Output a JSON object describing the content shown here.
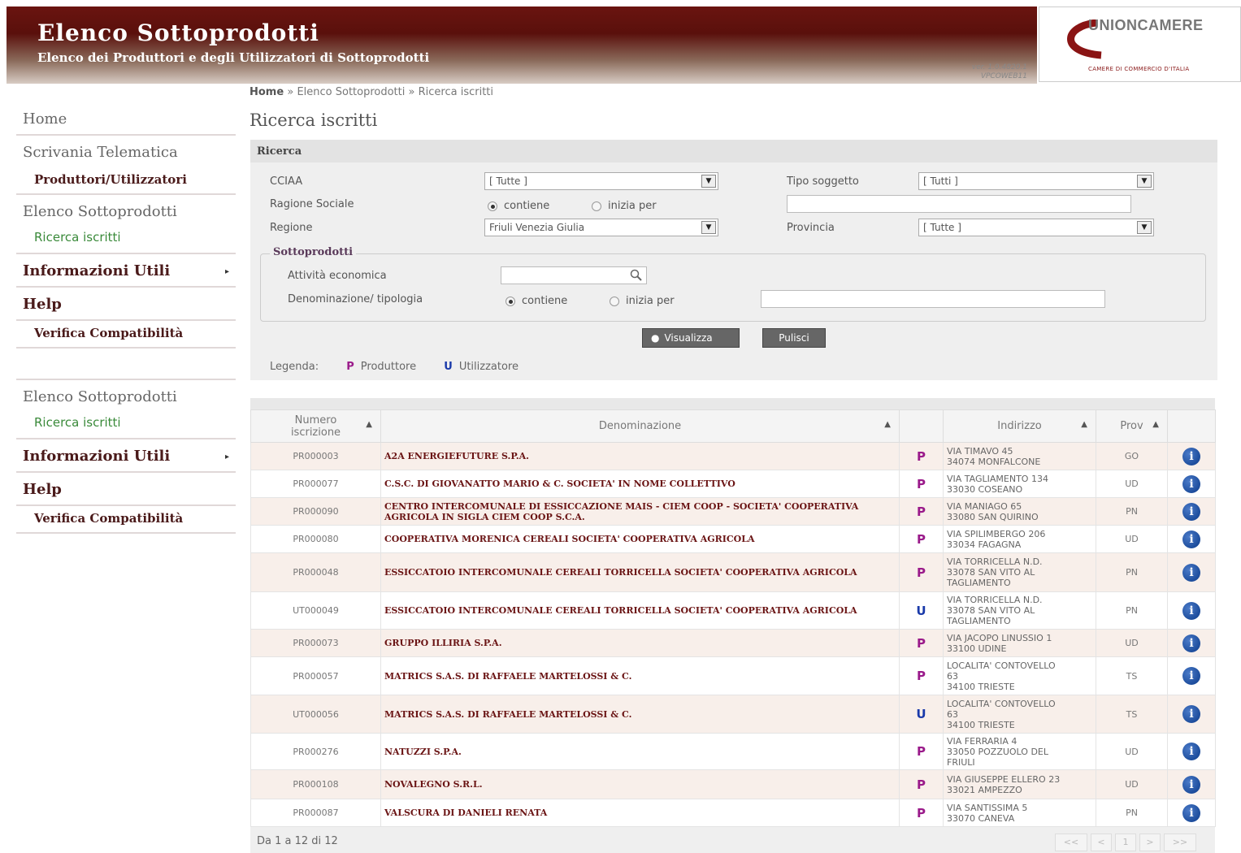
{
  "header": {
    "title": "Elenco Sottoprodotti",
    "subtitle": "Elenco dei Produttori e degli Utilizzatori di Sottoprodotti",
    "version_line1": "ver. 1.0.4820.1",
    "version_line2": "VPCOWEB11",
    "logo_text": "UNIONCAMERE",
    "logo_sub": "CAMERE DI COMMERCIO D'ITALIA"
  },
  "sidebar_top": {
    "home": "Home",
    "scrivania": "Scrivania Telematica",
    "produttori": "Produttori/Utilizzatori",
    "elenco": "Elenco Sottoprodotti",
    "ricerca": "Ricerca iscritti",
    "info": "Informazioni Utili",
    "help": "Help",
    "verifica": "Verifica Compatibilità"
  },
  "sidebar_bottom": {
    "elenco": "Elenco Sottoprodotti",
    "ricerca": "Ricerca iscritti",
    "info": "Informazioni Utili",
    "help": "Help",
    "verifica": "Verifica Compatibilità"
  },
  "breadcrumb": {
    "home": "Home",
    "sep": "»",
    "level1": "Elenco Sottoprodotti",
    "level2": "Ricerca iscritti"
  },
  "page_title": "Ricerca iscritti",
  "search": {
    "panel_title": "Ricerca",
    "cciaa_label": "CCIAA",
    "cciaa_value": "[ Tutte ]",
    "tipo_label": "Tipo soggetto",
    "tipo_value": "[ Tutti ]",
    "ragione_label": "Ragione Sociale",
    "opt_contiene": "contiene",
    "opt_inizia": "inizia per",
    "regione_label": "Regione",
    "regione_value": "Friuli Venezia Giulia",
    "provincia_label": "Provincia",
    "provincia_value": "[ Tutte ]",
    "sottoprodotti_legend": "Sottoprodotti",
    "attivita_label": "Attività economica",
    "denominazione_label": "Denominazione/ tipologia",
    "visualizza": "Visualizza",
    "pulisci": "Pulisci",
    "legenda_label": "Legenda:",
    "legend_p": "P",
    "legend_p_text": "Produttore",
    "legend_u": "U",
    "legend_u_text": "Utilizzatore"
  },
  "table": {
    "col_numero": "Numero iscrizione",
    "col_denominazione": "Denominazione",
    "col_indirizzo": "Indirizzo",
    "col_prov": "Prov",
    "rows": [
      {
        "num": "PR000003",
        "den": "A2A ENERGIEFUTURE S.P.A.",
        "type": "P",
        "addr": "VIA TIMAVO 45\n34074 MONFALCONE",
        "prov": "GO"
      },
      {
        "num": "PR000077",
        "den": "C.S.C. DI GIOVANATTO MARIO & C. SOCIETA' IN NOME COLLETTIVO",
        "type": "P",
        "addr": "VIA TAGLIAMENTO 134\n33030 COSEANO",
        "prov": "UD"
      },
      {
        "num": "PR000090",
        "den": "CENTRO INTERCOMUNALE DI ESSICCAZIONE MAIS - CIEM COOP - SOCIETA' COOPERATIVA AGRICOLA IN SIGLA CIEM COOP S.C.A.",
        "type": "P",
        "addr": "VIA MANIAGO 65\n33080 SAN QUIRINO",
        "prov": "PN"
      },
      {
        "num": "PR000080",
        "den": "COOPERATIVA MORENICA CEREALI SOCIETA' COOPERATIVA AGRICOLA",
        "type": "P",
        "addr": "VIA SPILIMBERGO 206\n33034 FAGAGNA",
        "prov": "UD"
      },
      {
        "num": "PR000048",
        "den": "ESSICCATOIO INTERCOMUNALE CEREALI TORRICELLA SOCIETA' COOPERATIVA AGRICOLA",
        "type": "P",
        "addr": "VIA TORRICELLA N.D.\n33078 SAN VITO AL\nTAGLIAMENTO",
        "prov": "PN"
      },
      {
        "num": "UT000049",
        "den": "ESSICCATOIO INTERCOMUNALE CEREALI TORRICELLA SOCIETA' COOPERATIVA AGRICOLA",
        "type": "U",
        "addr": "VIA TORRICELLA N.D.\n33078 SAN VITO AL\nTAGLIAMENTO",
        "prov": "PN"
      },
      {
        "num": "PR000073",
        "den": "GRUPPO ILLIRIA S.P.A.",
        "type": "P",
        "addr": "VIA JACOPO LINUSSIO 1\n33100 UDINE",
        "prov": "UD"
      },
      {
        "num": "PR000057",
        "den": "MATRICS S.A.S. DI RAFFAELE MARTELOSSI & C.",
        "type": "P",
        "addr": "LOCALITA' CONTOVELLO\n63\n34100 TRIESTE",
        "prov": "TS"
      },
      {
        "num": "UT000056",
        "den": "MATRICS S.A.S. DI RAFFAELE MARTELOSSI & C.",
        "type": "U",
        "addr": "LOCALITA' CONTOVELLO\n63\n34100 TRIESTE",
        "prov": "TS"
      },
      {
        "num": "PR000276",
        "den": "NATUZZI S.P.A.",
        "type": "P",
        "addr": "VIA FERRARIA 4\n33050 POZZUOLO DEL\nFRIULI",
        "prov": "UD"
      },
      {
        "num": "PR000108",
        "den": "NOVALEGNO S.R.L.",
        "type": "P",
        "addr": "VIA GIUSEPPE ELLERO 23\n33021 AMPEZZO",
        "prov": "UD"
      },
      {
        "num": "PR000087",
        "den": "VALSCURA DI DANIELI RENATA",
        "type": "P",
        "addr": "VIA SANTISSIMA 5\n33070 CANEVA",
        "prov": "PN"
      }
    ],
    "count_text": "Da 1 a 12 di 12",
    "pager": [
      "<<",
      "<",
      "1",
      ">",
      ">>"
    ]
  }
}
